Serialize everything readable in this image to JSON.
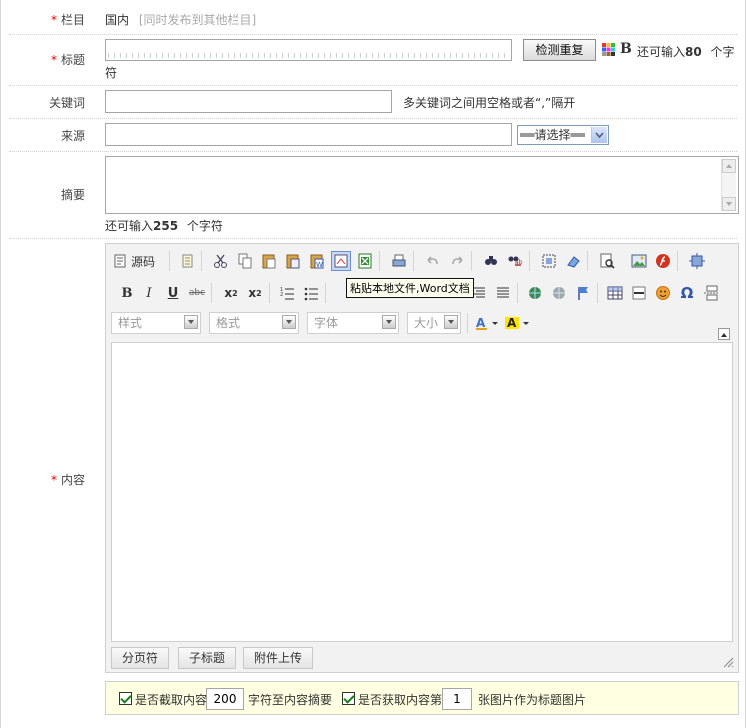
{
  "form": {
    "column": {
      "label": "栏目",
      "value": "国内",
      "publish_link": "[同时发布到其他栏目]"
    },
    "title": {
      "label": "标题",
      "check_button": "检测重复",
      "bold_icon": "B",
      "remain_prefix": "还可输入",
      "remain_count": "80",
      "remain_suffix": "个字",
      "wrap_char": "符"
    },
    "keywords": {
      "label": "关键词",
      "hint": "多关键词之间用空格或者“,”隔开"
    },
    "source": {
      "label": "来源",
      "select_value": "══请选择══"
    },
    "summary": {
      "label": "摘要",
      "remain_prefix": "还可输入",
      "remain_count": "255",
      "remain_suffix": "个字符"
    },
    "content": {
      "label": "内容"
    }
  },
  "editor": {
    "source_label": "源码",
    "style_placeholder": "样式",
    "format_placeholder": "格式",
    "font_placeholder": "字体",
    "size_placeholder": "大小",
    "tooltip": "粘贴本地文件,Word文档",
    "bottom_buttons": [
      "分页符",
      "子标题",
      "附件上传"
    ]
  },
  "options": {
    "cut_label": "是否截取内容",
    "cut_value": "200",
    "cut_suffix": "字符至内容摘要",
    "thumb_label": "是否获取内容第",
    "thumb_value": "1",
    "thumb_suffix": "张图片作为标题图片"
  },
  "colors": {
    "required": "#ee0000",
    "options_bg": "#ffffe1",
    "editor_bg": "#f2f2f2"
  }
}
